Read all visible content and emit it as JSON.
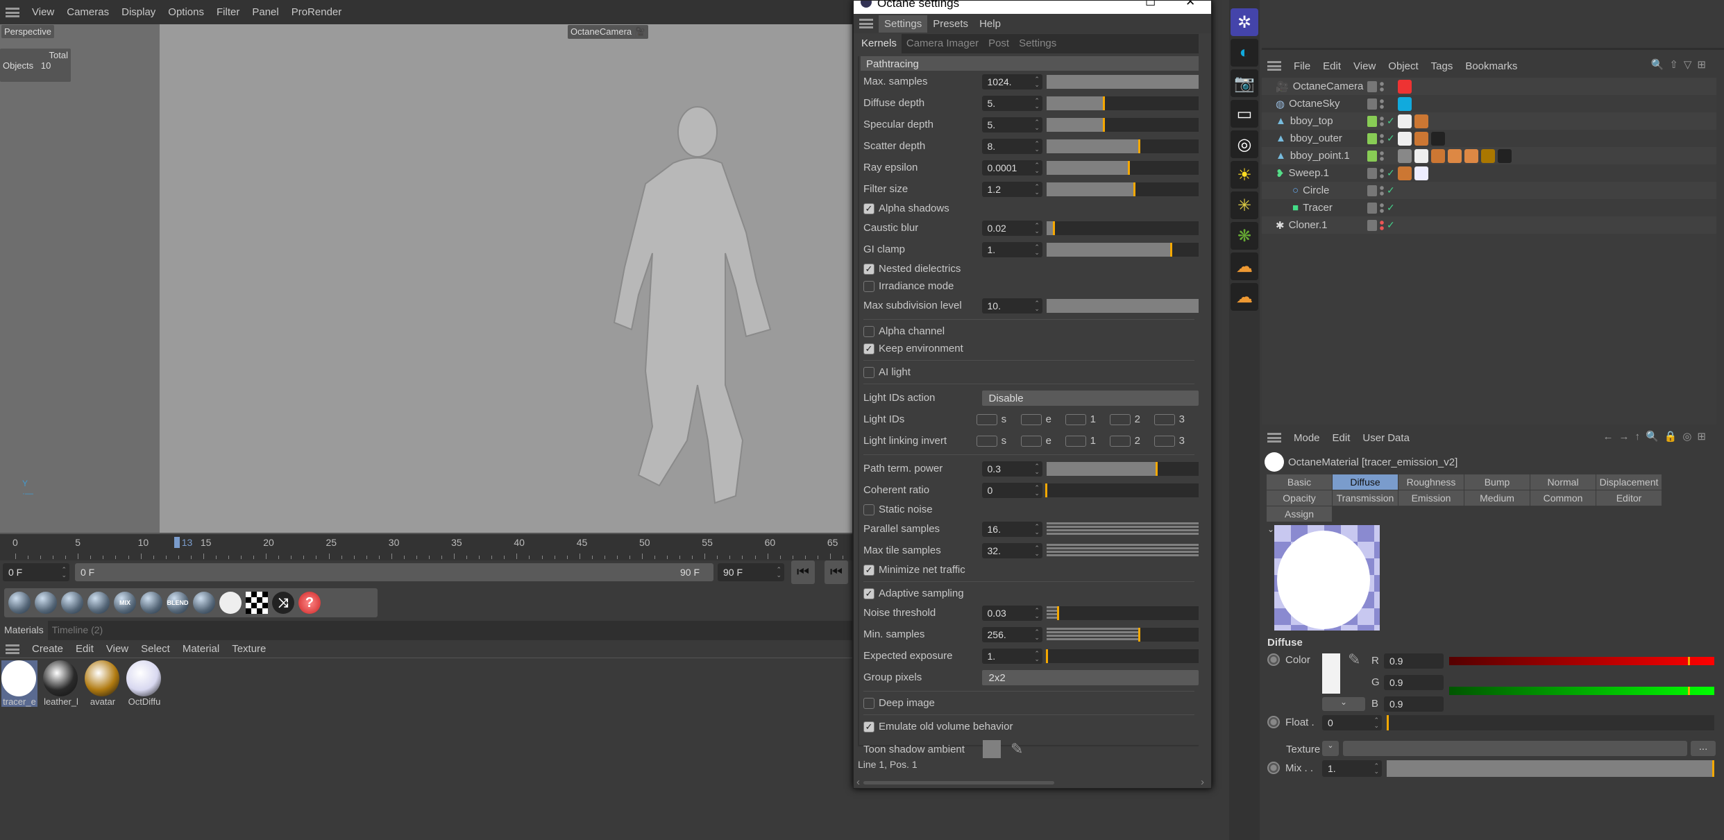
{
  "viewport": {
    "menu": [
      "View",
      "Cameras",
      "Display",
      "Options",
      "Filter",
      "Panel",
      "ProRender"
    ],
    "view_label": "Perspective",
    "camera_label": "OctaneCamera",
    "stats_header": "Total",
    "stats_label": "Objects",
    "stats_value": "10"
  },
  "timeline": {
    "ticks": [
      "0",
      "5",
      "10",
      "15",
      "20",
      "25",
      "30",
      "35",
      "40",
      "45",
      "50",
      "55",
      "60",
      "65"
    ],
    "current_frame": "13",
    "start_field": "0 F",
    "range_start": "0 F",
    "range_end": "90 F",
    "end_field": "90 F"
  },
  "material_toolbar": {
    "icons": [
      "diffuse-material",
      "glossy-material",
      "specular-material",
      "universal-material",
      "mix-material",
      "portal-material",
      "blend-material",
      "toon-material",
      "shadow-catcher",
      "checker-texture",
      "switch-material",
      "missing-material"
    ],
    "mix_label": "MIX",
    "blend_label": "BLEND"
  },
  "materials_panel": {
    "tabs": [
      "Materials",
      "Timeline (2)"
    ],
    "menu": [
      "Create",
      "Edit",
      "View",
      "Select",
      "Material",
      "Texture"
    ],
    "items": [
      {
        "name": "tracer_e",
        "color": "#ffffff"
      },
      {
        "name": "leather_l",
        "color": "#2a2a2a"
      },
      {
        "name": "avatar",
        "color": "#b07a10"
      },
      {
        "name": "OctDiffu",
        "color": "#d8d8f0"
      }
    ]
  },
  "octane": {
    "title": "Octane settings",
    "menu": [
      "Settings",
      "Presets",
      "Help"
    ],
    "tabs": [
      "Kernels",
      "Camera Imager",
      "Post",
      "Settings"
    ],
    "section": "Pathtracing",
    "rows": [
      {
        "t": "slider",
        "label": "Max. samples",
        "value": "1024.",
        "level": 1.0,
        "marker": false
      },
      {
        "t": "slider",
        "label": "Diffuse depth",
        "value": "5.",
        "level": 0.38
      },
      {
        "t": "slider",
        "label": "Specular depth",
        "value": "5.",
        "level": 0.38
      },
      {
        "t": "slider",
        "label": "Scatter depth",
        "value": "8.",
        "level": 0.61
      },
      {
        "t": "slider",
        "label": "Ray epsilon",
        "value": "0.0001",
        "level": 0.545
      },
      {
        "t": "slider",
        "label": "Filter size",
        "value": "1.2",
        "level": 0.58
      },
      {
        "t": "check",
        "label": "Alpha shadows",
        "checked": true
      },
      {
        "t": "slider",
        "label": "Caustic blur",
        "value": "0.02",
        "level": 0.05
      },
      {
        "t": "slider",
        "label": "GI clamp",
        "value": "1.",
        "level": 0.82
      },
      {
        "t": "check",
        "label": "Nested dielectrics",
        "checked": true
      },
      {
        "t": "check",
        "label": "Irradiance mode",
        "checked": false
      },
      {
        "t": "slider",
        "label": "Max subdivision level",
        "value": "10.",
        "level": 1.0,
        "marker": false
      },
      {
        "t": "sep"
      },
      {
        "t": "check",
        "label": "Alpha channel",
        "checked": false
      },
      {
        "t": "check",
        "label": "Keep environment",
        "checked": true
      },
      {
        "t": "sep"
      },
      {
        "t": "check",
        "label": "AI light",
        "checked": false
      },
      {
        "t": "sep"
      },
      {
        "t": "dropdown",
        "label": "Light IDs action",
        "value": "Disable"
      },
      {
        "t": "ids",
        "label": "Light IDs",
        "options": [
          "s",
          "e",
          "1",
          "2",
          "3"
        ]
      },
      {
        "t": "ids",
        "label": "Light linking invert",
        "options": [
          "s",
          "e",
          "1",
          "2",
          "3"
        ]
      },
      {
        "t": "sep"
      },
      {
        "t": "slider",
        "label": "Path term. power",
        "value": "0.3",
        "level": 0.725
      },
      {
        "t": "slider",
        "label": "Coherent ratio",
        "value": "0",
        "level": 0
      },
      {
        "t": "check",
        "label": "Static noise",
        "checked": false
      },
      {
        "t": "slider",
        "label": "Parallel samples",
        "value": "16.",
        "level": 1.0,
        "marker": false,
        "striped": true
      },
      {
        "t": "slider",
        "label": "Max tile samples",
        "value": "32.",
        "level": 1.0,
        "marker": false,
        "striped": true
      },
      {
        "t": "check",
        "label": "Minimize net traffic",
        "checked": true
      },
      {
        "t": "sep"
      },
      {
        "t": "check",
        "label": "Adaptive sampling",
        "checked": true
      },
      {
        "t": "slider",
        "label": "Noise threshold",
        "value": "0.03",
        "level": 0.08,
        "striped": true
      },
      {
        "t": "slider",
        "label": "Min. samples",
        "value": "256.",
        "level": 0.61,
        "striped": true
      },
      {
        "t": "slider",
        "label": "Expected exposure",
        "value": "1.",
        "level": 0.005
      },
      {
        "t": "dropdown",
        "label": "Group pixels",
        "value": "2x2"
      },
      {
        "t": "sep"
      },
      {
        "t": "check",
        "label": "Deep image",
        "checked": false
      },
      {
        "t": "sep"
      },
      {
        "t": "check",
        "label": "Emulate old volume behavior",
        "checked": true
      },
      {
        "t": "color",
        "label": "Toon shadow ambient",
        "color": "#808080"
      }
    ],
    "status": "Line 1, Pos. 1"
  },
  "object_manager": {
    "menu": [
      "File",
      "Edit",
      "View",
      "Object",
      "Tags",
      "Bookmarks"
    ],
    "objects": [
      {
        "name": "OctaneCamera",
        "icon": "camera",
        "green": false,
        "check": false,
        "tags": [
          "#e33"
        ]
      },
      {
        "name": "OctaneSky",
        "icon": "sky",
        "green": false,
        "check": false,
        "tags": [
          "#1ad"
        ]
      },
      {
        "name": "bboy_top",
        "icon": "mesh",
        "green": true,
        "check": true,
        "tags": [
          "#eee",
          "#c73"
        ]
      },
      {
        "name": "bboy_outer",
        "icon": "mesh",
        "green": true,
        "check": true,
        "tags": [
          "#eee",
          "#c73",
          "#222"
        ]
      },
      {
        "name": "bboy_point.1",
        "icon": "mesh",
        "green": true,
        "check": false,
        "tags": [
          "#888",
          "#eee",
          "#c73",
          "#d84",
          "#d84",
          "#a70",
          "#222"
        ]
      },
      {
        "name": "Sweep.1",
        "icon": "sweep",
        "green": false,
        "check": true,
        "tags": [
          "#c73",
          "#eef"
        ]
      },
      {
        "name": "Circle",
        "icon": "circle",
        "green": false,
        "check": true,
        "tags": [],
        "indent": true
      },
      {
        "name": "Tracer",
        "icon": "cube",
        "green": false,
        "check": true,
        "tags": [],
        "indent": true
      },
      {
        "name": "Cloner.1",
        "icon": "cloner",
        "green": false,
        "check": true,
        "red": true,
        "tags": []
      }
    ]
  },
  "attributes": {
    "menu": [
      "Mode",
      "Edit",
      "User Data"
    ],
    "title": "OctaneMaterial [tracer_emission_v2]",
    "tabs": [
      "Basic",
      "Diffuse",
      "Roughness",
      "Bump",
      "Normal",
      "Displacement",
      "Opacity",
      "Transmission",
      "Emission",
      "Medium",
      "Common",
      "Editor",
      "Assign"
    ],
    "active_tab": "Diffuse",
    "section": "Diffuse",
    "color_label": "Color",
    "r_label": "R",
    "g_label": "G",
    "b_label": "B",
    "r": "0.9",
    "g": "0.9",
    "b": "0.9",
    "rgb_level": 0.9,
    "float_label": "Float .",
    "float_value": "0",
    "texture_label": "Texture",
    "texture_button": "...",
    "mix_label": "Mix . .",
    "mix_value": "1.",
    "mix_level": 1.0
  }
}
